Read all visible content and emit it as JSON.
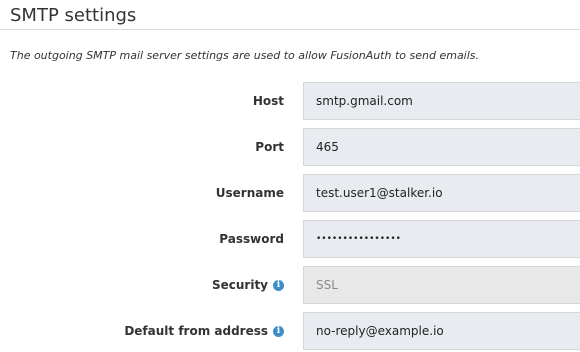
{
  "section": {
    "title": "SMTP settings",
    "description": "The outgoing SMTP mail server settings are used to allow FusionAuth to send emails."
  },
  "fields": {
    "host": {
      "label": "Host",
      "value": "smtp.gmail.com"
    },
    "port": {
      "label": "Port",
      "value": "465"
    },
    "username": {
      "label": "Username",
      "value": "test.user1@stalker.io"
    },
    "password": {
      "label": "Password",
      "value": "••••••••••••••••"
    },
    "security": {
      "label": "Security",
      "value": "SSL",
      "disabled": true,
      "icon": "info-icon"
    },
    "default_from_address": {
      "label": "Default from address",
      "value": "no-reply@example.io",
      "icon": "info-icon"
    }
  },
  "colors": {
    "input_background": "#e8ecf1",
    "disabled_background": "#e8e8e8",
    "info_icon": "#3d8fc6"
  }
}
